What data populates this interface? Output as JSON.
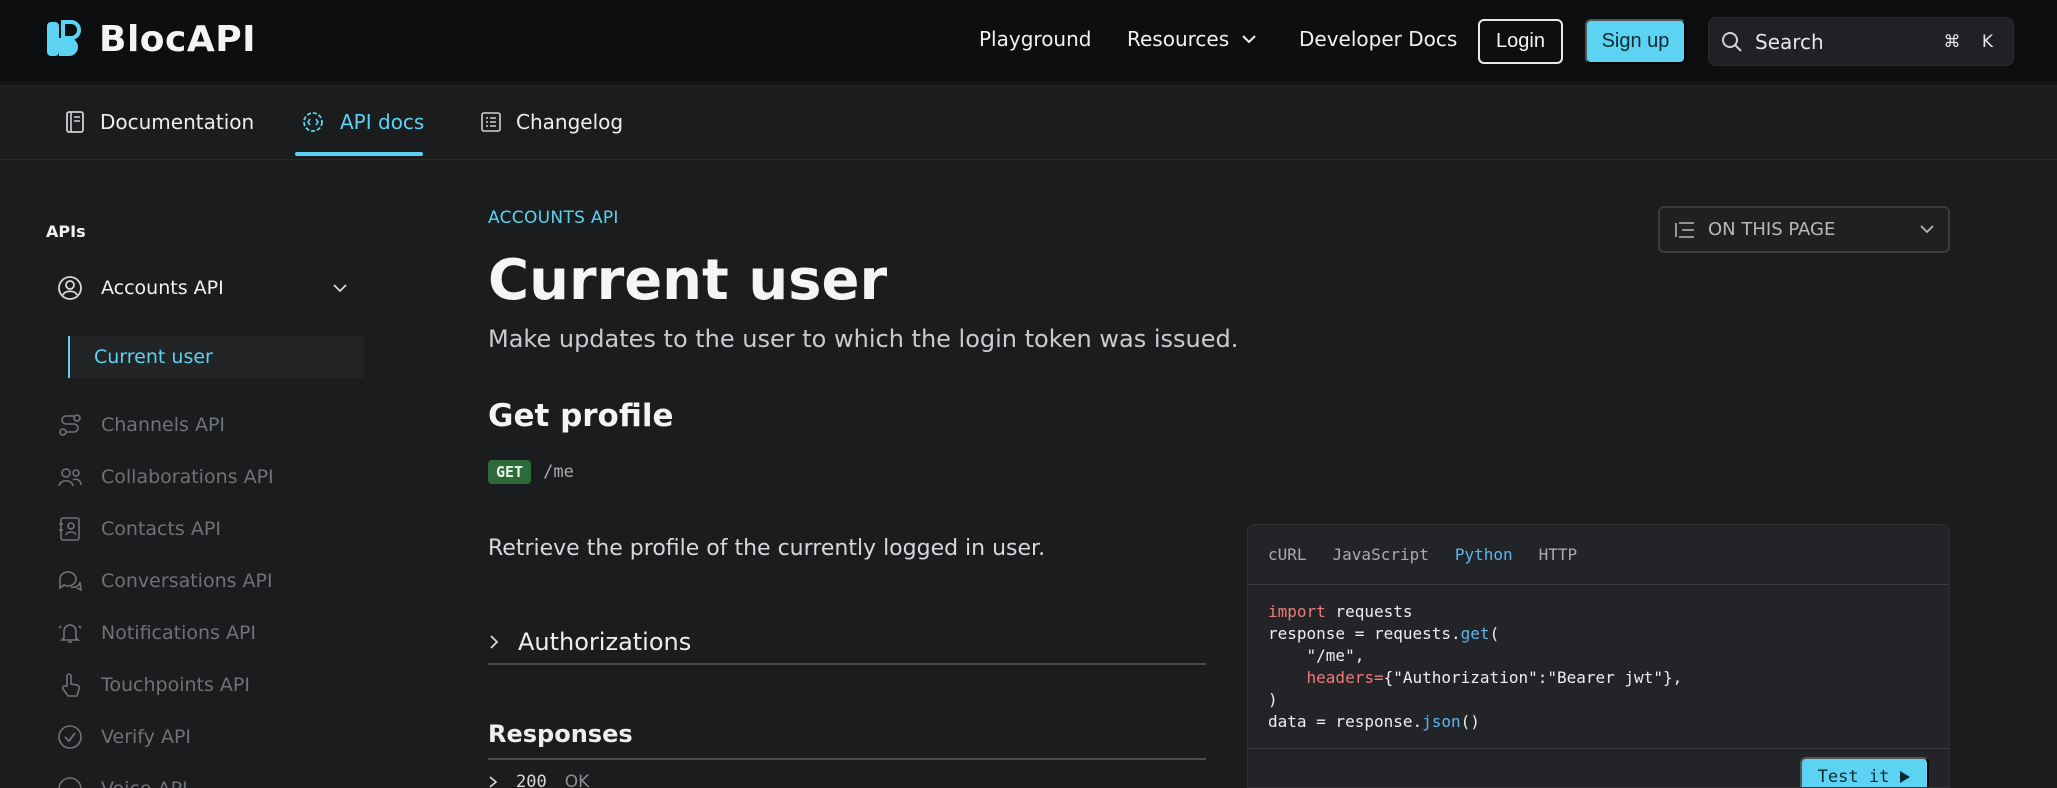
{
  "brand": {
    "name": "BlocAPI",
    "accent": "#5cd3f3"
  },
  "topnav": {
    "links": [
      "Playground",
      "Resources",
      "Developer Docs"
    ],
    "login_label": "Login",
    "signup_label": "Sign up",
    "search": {
      "placeholder": "Search",
      "shortcut": "⌘ K"
    }
  },
  "subnav": {
    "tabs": [
      {
        "label": "Documentation",
        "icon": "book-icon"
      },
      {
        "label": "API docs",
        "icon": "gear-code-icon",
        "active": true
      },
      {
        "label": "Changelog",
        "icon": "list-icon"
      }
    ]
  },
  "sidebar": {
    "heading": "APIs",
    "expanded": {
      "label": "Accounts API",
      "icon": "user-circle-icon"
    },
    "sub_item": "Current user",
    "items": [
      {
        "label": "Channels API",
        "icon": "route-icon"
      },
      {
        "label": "Collaborations API",
        "icon": "users-icon"
      },
      {
        "label": "Contacts API",
        "icon": "contact-card-icon"
      },
      {
        "label": "Conversations API",
        "icon": "chat-icon"
      },
      {
        "label": "Notifications API",
        "icon": "bell-icon"
      },
      {
        "label": "Touchpoints API",
        "icon": "pointer-icon"
      },
      {
        "label": "Verify API",
        "icon": "check-circle-icon"
      },
      {
        "label": "Voice API",
        "icon": "phone-icon"
      }
    ]
  },
  "content": {
    "eyebrow": "ACCOUNTS API",
    "title": "Current user",
    "lede": "Make updates to the user to which the login token was issued.",
    "section_title": "Get profile",
    "method": "GET",
    "path": "/me",
    "description": "Retrieve the profile of the currently logged in user.",
    "authorizations_label": "Authorizations",
    "responses_label": "Responses",
    "response_row": {
      "code": "200",
      "text": "OK"
    },
    "on_this_page": "ON THIS PAGE"
  },
  "code_panel": {
    "tabs": [
      "cURL",
      "JavaScript",
      "Python",
      "HTTP"
    ],
    "active_tab": "Python",
    "test_label": "Test it"
  }
}
